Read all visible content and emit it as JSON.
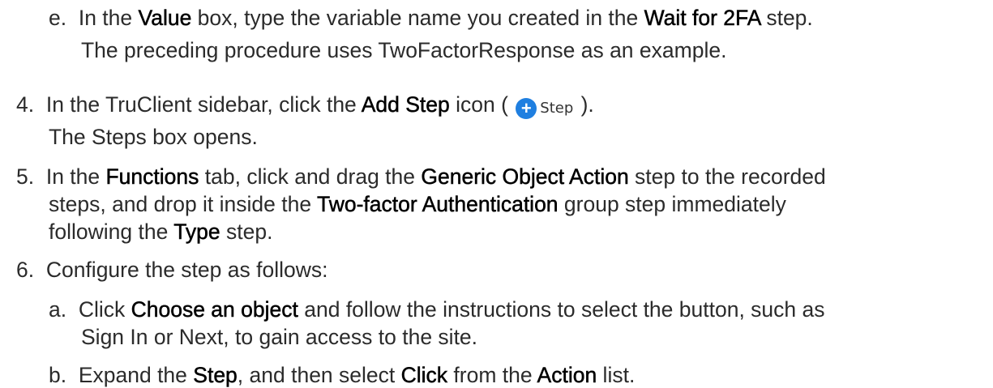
{
  "lines": {
    "e1": {
      "p1": "e.  In the ",
      "b1": "Value",
      "p2": " box, type the variable name you created in the ",
      "b2": "Wait for 2FA",
      "p3": " step."
    },
    "e2": "The preceding procedure uses TwoFactorResponse as an example.",
    "s4": {
      "p1": "4.  In the TruClient sidebar, click the ",
      "b1": "Add Step",
      "p2": " icon ( ",
      "p3": " )."
    },
    "s4b": "The Steps box opens.",
    "s5a": {
      "p1": "5.  In the ",
      "b1": "Functions",
      "p2": " tab, click and drag the ",
      "b2": "Generic Object Action",
      "p3": " step to the recorded"
    },
    "s5b": {
      "p1": "steps, and drop it inside the ",
      "b1": "Two-factor Authentication",
      "p2": " group step immediately"
    },
    "s5c": {
      "p1": "following the ",
      "b1": "Type",
      "p2": " step."
    },
    "s6": "6.  Configure the step as follows:",
    "a1": {
      "p1": "a.  Click ",
      "b1": "Choose an object",
      "p2": " and follow the instructions to select the button, such as"
    },
    "a2": "Sign In or Next, to gain access to the site.",
    "b": {
      "p1": "b.  Expand the ",
      "b1": "Step",
      "p2": ", and then select ",
      "b2": "Click",
      "p3": " from the ",
      "b3": "Action",
      "p4": " list."
    }
  },
  "step_icon": {
    "icon": "plus-circle-icon",
    "label": "Step",
    "color": "#1f7fe0"
  }
}
